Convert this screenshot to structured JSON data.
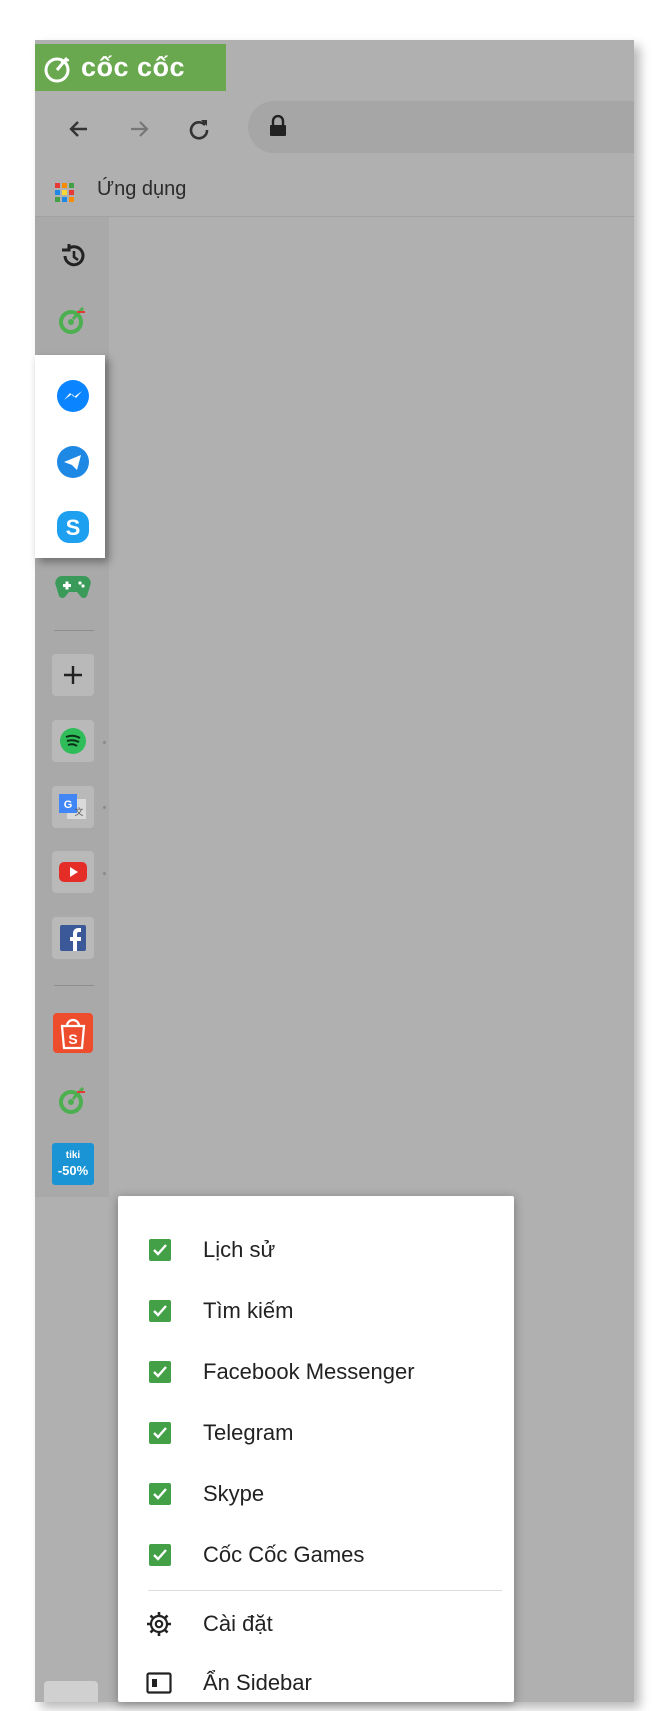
{
  "browser": {
    "brand_name": "cốc cốc",
    "bookmarks_label": "Ứng dụng"
  },
  "sidebar": {
    "icons": [
      "history-icon",
      "coccoc-search-icon",
      "messenger-icon",
      "telegram-icon",
      "skype-icon",
      "games-icon",
      "add-icon",
      "spotify-icon",
      "google-translate-icon",
      "youtube-icon",
      "facebook-icon",
      "shopee-icon",
      "coccoc-icon",
      "tiki-icon"
    ],
    "tiki_label_top": "tiki",
    "tiki_label_bottom": "-50%"
  },
  "menu": {
    "items": [
      {
        "label": "Lịch sử",
        "checked": true
      },
      {
        "label": "Tìm kiếm",
        "checked": true
      },
      {
        "label": "Facebook Messenger",
        "checked": true
      },
      {
        "label": "Telegram",
        "checked": true
      },
      {
        "label": "Skype",
        "checked": true
      },
      {
        "label": "Cốc Cốc Games",
        "checked": true
      }
    ],
    "settings_label": "Cài đặt",
    "hide_sidebar_label": "Ẩn Sidebar"
  },
  "colors": {
    "brand_green": "#6aa84f",
    "checkbox_green": "#43a047",
    "messenger_blue": "#0a84ff",
    "telegram_blue": "#1e88e5",
    "skype_blue": "#1ea0f0",
    "spotify_green": "#2ebd59",
    "youtube_red": "#e52d27",
    "facebook_blue": "#3b5998",
    "shopee_orange": "#ee4d2d"
  }
}
